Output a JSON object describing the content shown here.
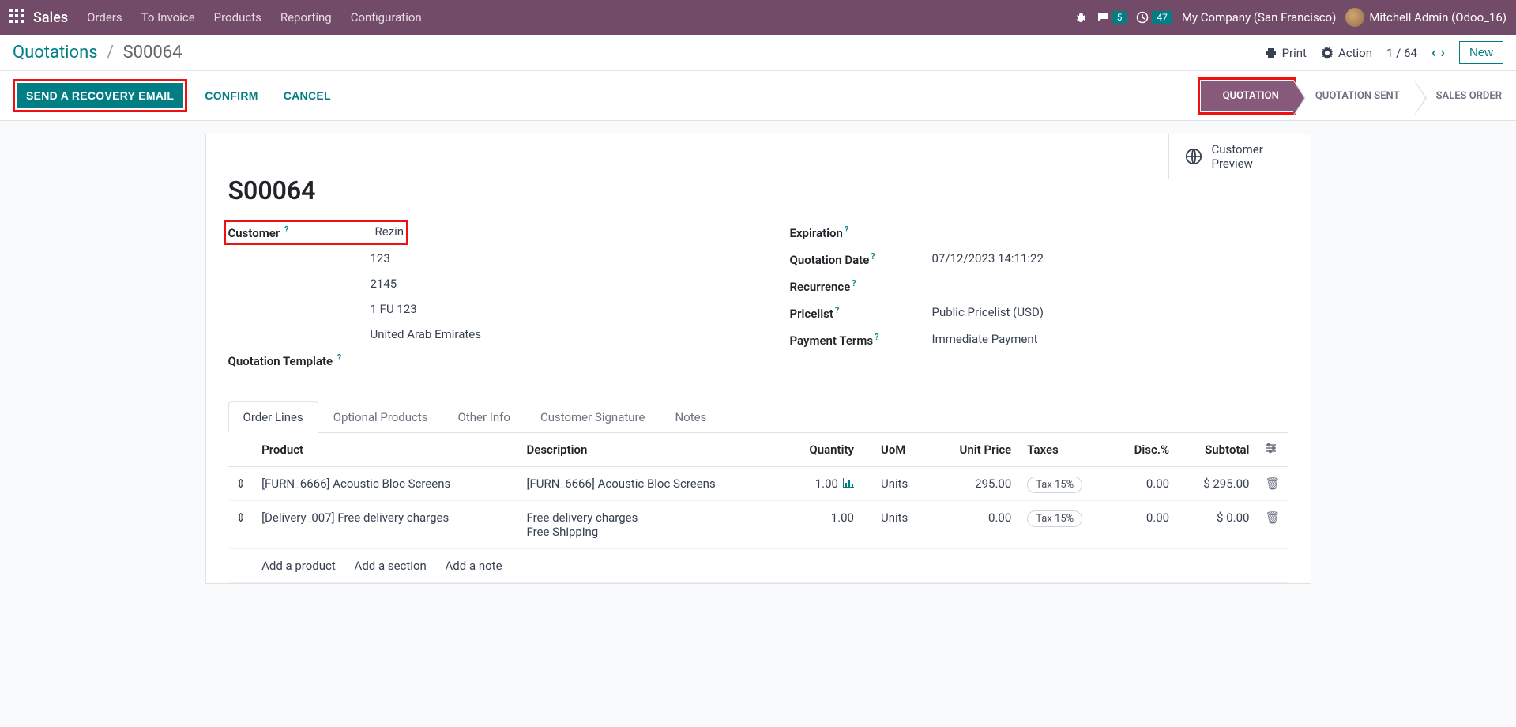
{
  "topbar": {
    "module": "Sales",
    "menus": [
      "Orders",
      "To Invoice",
      "Products",
      "Reporting",
      "Configuration"
    ],
    "msg_badge": "5",
    "activity_badge": "47",
    "company": "My Company (San Francisco)",
    "user": "Mitchell Admin (Odoo_16)"
  },
  "breadcrumb": {
    "root": "Quotations",
    "current": "S00064"
  },
  "cp": {
    "print": "Print",
    "action": "Action",
    "pager": "1 / 64",
    "new": "New"
  },
  "actions": {
    "recovery": "SEND A RECOVERY EMAIL",
    "confirm": "CONFIRM",
    "cancel": "CANCEL"
  },
  "status": {
    "s1": "QUOTATION",
    "s2": "QUOTATION SENT",
    "s3": "SALES ORDER"
  },
  "preview": "Customer Preview",
  "record": {
    "name": "S00064",
    "customer_label": "Customer",
    "customer_name": "Rezin",
    "addr1": "123",
    "addr2": "2145",
    "addr3": "1 FU 123",
    "addr4": "United Arab Emirates",
    "qt_template_label": "Quotation Template",
    "exp_label": "Expiration",
    "qdate_label": "Quotation Date",
    "qdate_val": "07/12/2023 14:11:22",
    "recur_label": "Recurrence",
    "pricelist_label": "Pricelist",
    "pricelist_val": "Public Pricelist (USD)",
    "payterms_label": "Payment Terms",
    "payterms_val": "Immediate Payment"
  },
  "tabs": {
    "t1": "Order Lines",
    "t2": "Optional Products",
    "t3": "Other Info",
    "t4": "Customer Signature",
    "t5": "Notes"
  },
  "cols": {
    "product": "Product",
    "description": "Description",
    "qty": "Quantity",
    "uom": "UoM",
    "price": "Unit Price",
    "taxes": "Taxes",
    "disc": "Disc.%",
    "subtotal": "Subtotal"
  },
  "lines": [
    {
      "product": "[FURN_6666] Acoustic Bloc Screens",
      "desc": "[FURN_6666] Acoustic Bloc Screens",
      "qty": "1.00",
      "uom": "Units",
      "price": "295.00",
      "tax": "Tax 15%",
      "disc": "0.00",
      "subtotal": "$ 295.00",
      "has_chart": true
    },
    {
      "product": "[Delivery_007] Free delivery charges",
      "desc": "Free delivery charges\nFree Shipping",
      "qty": "1.00",
      "uom": "Units",
      "price": "0.00",
      "tax": "Tax 15%",
      "disc": "0.00",
      "subtotal": "$ 0.00",
      "has_chart": false
    }
  ],
  "add": {
    "product": "Add a product",
    "section": "Add a section",
    "note": "Add a note"
  }
}
